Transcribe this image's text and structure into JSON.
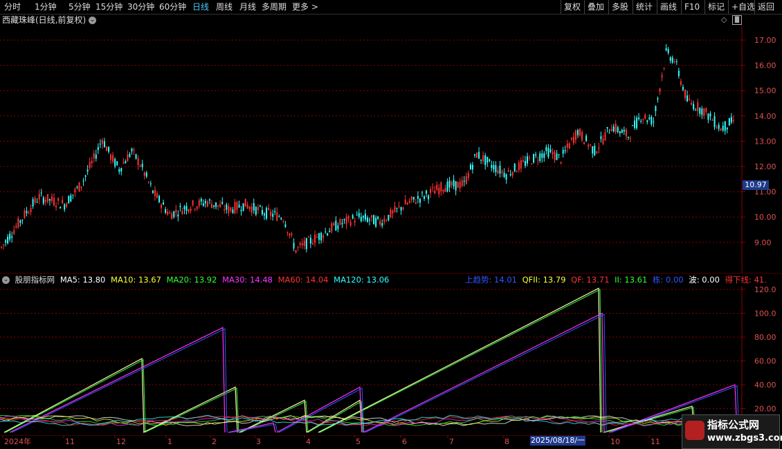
{
  "toolbar": {
    "periods": [
      "分时",
      "1分钟",
      "5分钟",
      "15分钟",
      "30分钟",
      "60分钟",
      "日线",
      "周线",
      "月线",
      "多周期",
      "更多 >"
    ],
    "active": "日线",
    "right_buttons": [
      "复权",
      "叠加",
      "多股",
      "统计",
      "画线",
      "F10",
      "标记",
      "+自选",
      "返回"
    ]
  },
  "main_chart": {
    "title": "西藏珠峰(日线,前复权)",
    "y_ticks": [
      "17.00",
      "16.00",
      "15.00",
      "14.00",
      "13.00",
      "12.00",
      "11.00",
      "10.00",
      "9.00"
    ],
    "current_price": "10.97"
  },
  "indicator": {
    "name": "股朋指标网",
    "items": [
      {
        "label": "MA5: 13.80",
        "color": "#ffffff"
      },
      {
        "label": "MA10: 13.67",
        "color": "#ffff33"
      },
      {
        "label": "MA20: 13.92",
        "color": "#33ff33"
      },
      {
        "label": "MA30: 14.48",
        "color": "#ff33ff"
      },
      {
        "label": "MA60: 14.04",
        "color": "#ff3333"
      },
      {
        "label": "MA120: 13.06",
        "color": "#33ffff"
      }
    ],
    "right_items": [
      {
        "label": "上趋势: 14.01",
        "color": "#3355ff"
      },
      {
        "label": "QFII: 13.79",
        "color": "#ffff33"
      },
      {
        "label": "QF: 13.71",
        "color": "#ff3333"
      },
      {
        "label": "II: 13.61",
        "color": "#33ff33"
      },
      {
        "label": "栋: 0.00",
        "color": "#3355ff"
      },
      {
        "label": "波: 0.00",
        "color": "#ffffff"
      },
      {
        "label": "得下线: 41.",
        "color": "#ff3333"
      }
    ],
    "y_ticks": [
      "120.0",
      "100.0",
      "80.00",
      "60.00",
      "40.00",
      "20.00"
    ]
  },
  "x_axis": {
    "labels": [
      "2024年",
      "11",
      "12",
      "1",
      "2",
      "3",
      "4",
      "5",
      "6",
      "7",
      "8",
      "10",
      "11"
    ],
    "date_cursor": "2025/08/18/一"
  },
  "watermark": {
    "title": "指标公式网",
    "url": "www.zbgs3.com"
  },
  "colors": {
    "up": "#ff3333",
    "down": "#33ffff",
    "grid": "#8b0000"
  }
}
